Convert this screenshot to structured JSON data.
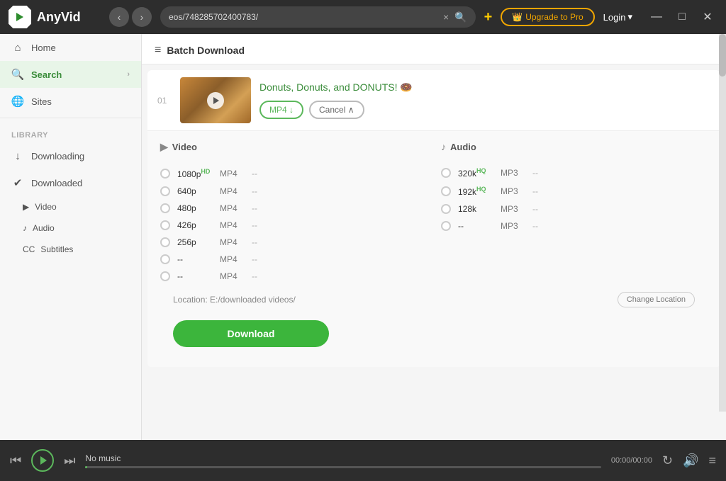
{
  "app": {
    "name": "AnyVid"
  },
  "titlebar": {
    "address": "eos/748285702400783/",
    "close_tab": "×",
    "upgrade_label": "Upgrade to Pro",
    "login_label": "Login",
    "minimize": "—",
    "maximize": "□",
    "close": "✕"
  },
  "sidebar": {
    "home_label": "Home",
    "search_label": "Search",
    "sites_label": "Sites",
    "library_label": "Library",
    "downloading_label": "Downloading",
    "downloaded_label": "Downloaded",
    "video_label": "Video",
    "audio_label": "Audio",
    "subtitles_label": "Subtitles"
  },
  "batch": {
    "title": "Batch Download",
    "item_num": "01",
    "video_title": "Donuts, Donuts, and DONUTS! 🍩",
    "mp4_label": "MP4 ↓",
    "cancel_label": "Cancel ∧",
    "video_col": "Video",
    "audio_col": "Audio",
    "location_text": "Location: E:/downloaded videos/",
    "change_location_label": "Change Location",
    "download_label": "Download"
  },
  "video_formats": [
    {
      "res": "1080p",
      "hq": "HD",
      "type": "MP4",
      "size": "--"
    },
    {
      "res": "640p",
      "hq": "",
      "type": "MP4",
      "size": "--"
    },
    {
      "res": "480p",
      "hq": "",
      "type": "MP4",
      "size": "--"
    },
    {
      "res": "426p",
      "hq": "",
      "type": "MP4",
      "size": "--"
    },
    {
      "res": "256p",
      "hq": "",
      "type": "MP4",
      "size": "--"
    },
    {
      "res": "--",
      "hq": "",
      "type": "MP4",
      "size": "--"
    },
    {
      "res": "--",
      "hq": "",
      "type": "MP4",
      "size": "--"
    }
  ],
  "audio_formats": [
    {
      "res": "320k",
      "hq": "HQ",
      "type": "MP3",
      "size": "--"
    },
    {
      "res": "192k",
      "hq": "HQ",
      "type": "MP3",
      "size": "--"
    },
    {
      "res": "128k",
      "hq": "",
      "type": "MP3",
      "size": "--"
    },
    {
      "res": "--",
      "hq": "",
      "type": "MP3",
      "size": "--"
    }
  ],
  "player": {
    "track": "No music",
    "time": "00:00/00:00"
  }
}
